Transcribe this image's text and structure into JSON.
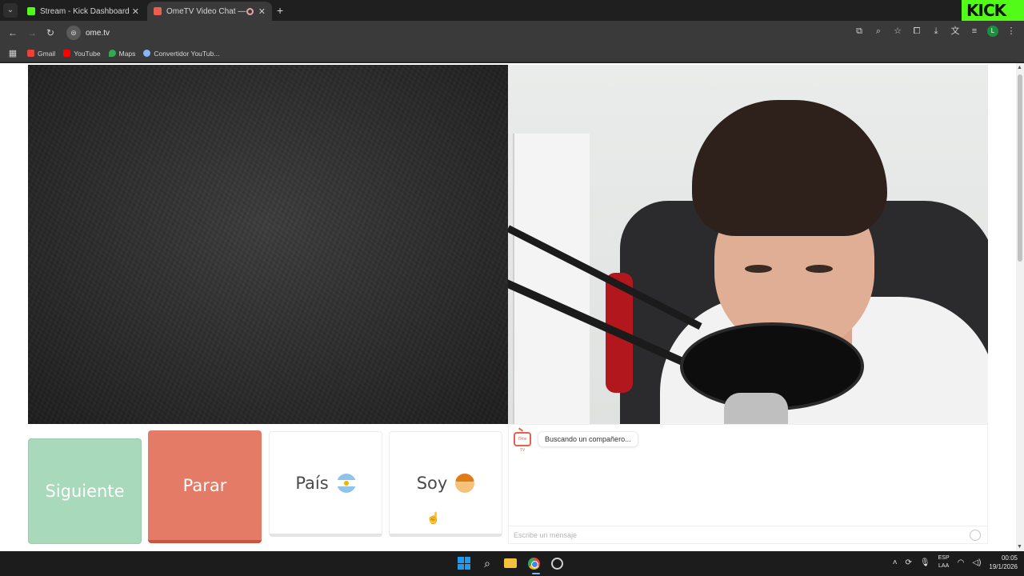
{
  "browser": {
    "tabs": [
      {
        "title": "Stream - Kick Dashboard",
        "favicon_color": "#53fc18"
      },
      {
        "title": "OmeTV Video Chat — Ome",
        "favicon_color": "#e8604c"
      }
    ],
    "address": "ome.tv",
    "bookmarks": [
      {
        "label": "Gmail",
        "color": "#ea4335"
      },
      {
        "label": "YouTube",
        "color": "#ff0000"
      },
      {
        "label": "Maps",
        "color": "#34a853"
      },
      {
        "label": "Convertidor YouTub...",
        "color": "#8ab4f8"
      }
    ],
    "overlay_logo": "KICK",
    "profile_initial": "L"
  },
  "controls": {
    "next_label": "Siguiente",
    "stop_label": "Parar",
    "country_label": "País",
    "gender_label": "Soy"
  },
  "chat": {
    "status_message": "Buscando un compañero...",
    "input_placeholder": "Escribe un mensaje",
    "brand_icon_text": "Ome TV"
  },
  "taskbar": {
    "language": "ESP",
    "layout": "LAA",
    "time": "00:05",
    "date": "19/1/2026"
  },
  "colors": {
    "next": "#a8d9bb",
    "stop": "#e47b66",
    "kick": "#53fc18"
  }
}
